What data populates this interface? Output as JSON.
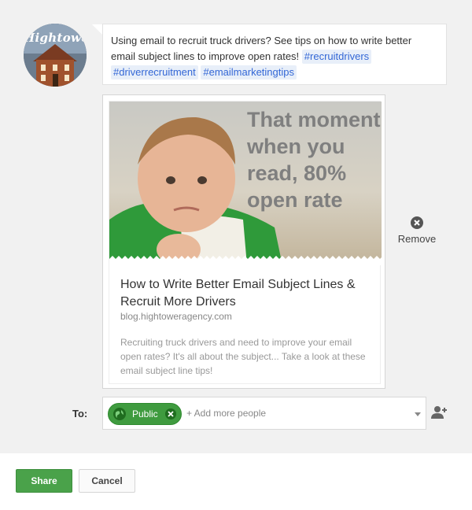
{
  "post": {
    "avatar_text": "Hightower",
    "text": "Using email to recruit truck drivers? See tips on how to write better email subject lines to improve open rates! ",
    "hashtags": [
      "#recruitdrivers",
      "#driverrecruitment",
      "#emailmarketingtips"
    ]
  },
  "link_card": {
    "image_text": "That moment when you read, 80% open rate",
    "title": "How to Write Better Email Subject Lines & Recruit More Drivers",
    "domain": "blog.hightoweragency.com",
    "description": "Recruiting truck drivers and need to improve your email open rates? It's all about the subject... Take a look at these email subject line tips!",
    "remove_label": "Remove"
  },
  "audience": {
    "to_label": "To:",
    "chip_label": "Public",
    "placeholder": "+ Add more people"
  },
  "footer": {
    "share_label": "Share",
    "cancel_label": "Cancel"
  },
  "colors": {
    "accent_green": "#4aa24a",
    "hashtag_bg": "#e8eff9",
    "hashtag_text": "#3367d6"
  },
  "icons": {
    "remove": "close-circle-icon",
    "globe": "globe-icon",
    "chip_remove": "close-circle-icon",
    "add_person": "add-person-icon",
    "dropdown": "chevron-down-icon"
  }
}
